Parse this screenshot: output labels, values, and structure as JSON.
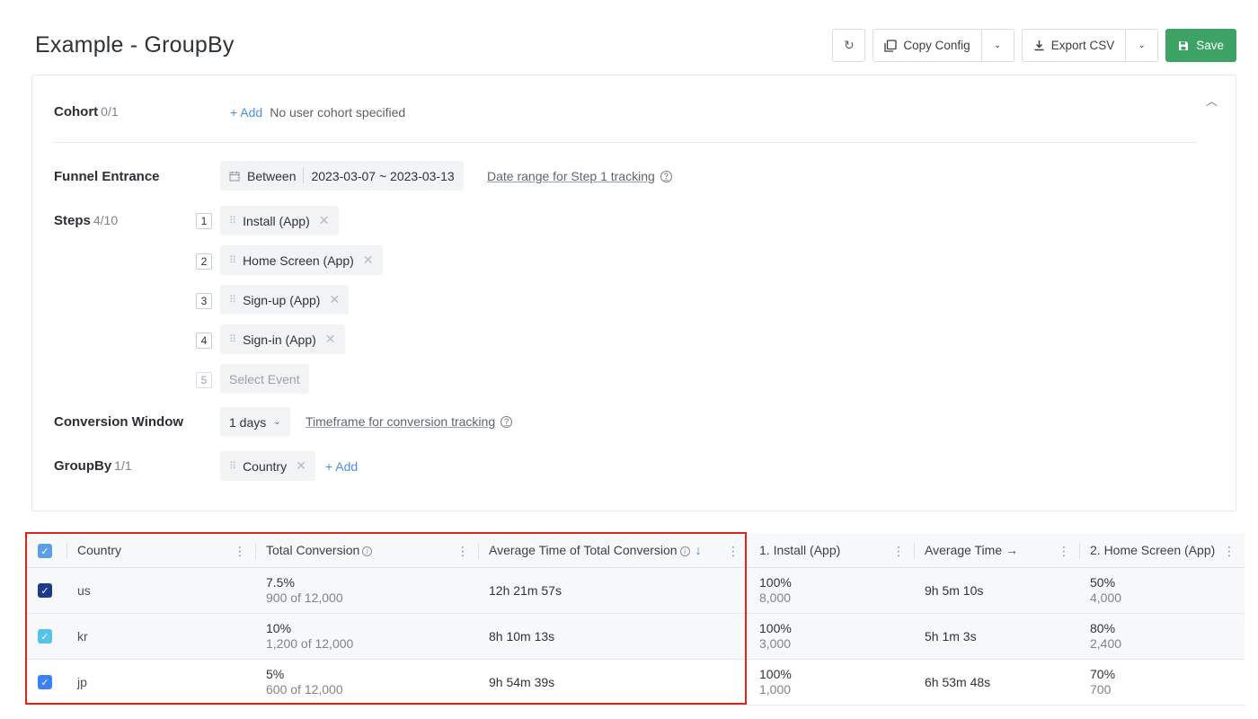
{
  "title": "Example - GroupBy",
  "toolbar": {
    "copy_config": "Copy Config",
    "export_csv": "Export CSV",
    "save": "Save"
  },
  "config": {
    "cohort": {
      "label": "Cohort",
      "count": "0/1",
      "add": "+ Add",
      "empty": "No user cohort specified"
    },
    "funnel_entrance": {
      "label": "Funnel Entrance",
      "mode": "Between",
      "range": "2023-03-07 ~ 2023-03-13",
      "help_link": "Date range for Step 1 tracking"
    },
    "steps": {
      "label": "Steps",
      "count": "4/10",
      "items": [
        {
          "num": "1",
          "name": "Install (App)"
        },
        {
          "num": "2",
          "name": "Home Screen (App)"
        },
        {
          "num": "3",
          "name": "Sign-up (App)"
        },
        {
          "num": "4",
          "name": "Sign-in (App)"
        }
      ],
      "next_num": "5",
      "select_placeholder": "Select Event"
    },
    "conversion_window": {
      "label": "Conversion Window",
      "value": "1 days",
      "help_link": "Timeframe for conversion tracking"
    },
    "groupby": {
      "label": "GroupBy",
      "count": "1/1",
      "item": "Country",
      "add": "+ Add"
    }
  },
  "table": {
    "headers": {
      "country": "Country",
      "total_conversion": "Total Conversion",
      "avg_time_total": "Average Time of Total Conversion",
      "step1": "1. Install (App)",
      "avg_time": "Average Time →",
      "step2": "2. Home Screen (App)"
    },
    "rows": [
      {
        "country": "us",
        "conv_pct": "7.5%",
        "conv_of": "900 of 12,000",
        "avg_total": "12h 21m 57s",
        "s1_pct": "100%",
        "s1_count": "8,000",
        "avg": "9h 5m 10s",
        "s2_pct": "50%",
        "s2_count": "4,000",
        "color": "#1f3a8a"
      },
      {
        "country": "kr",
        "conv_pct": "10%",
        "conv_of": "1,200 of 12,000",
        "avg_total": "8h 10m 13s",
        "s1_pct": "100%",
        "s1_count": "3,000",
        "avg": "5h 1m 3s",
        "s2_pct": "80%",
        "s2_count": "2,400",
        "color": "#56c2ea"
      },
      {
        "country": "jp",
        "conv_pct": "5%",
        "conv_of": "600 of 12,000",
        "avg_total": "9h 54m 39s",
        "s1_pct": "100%",
        "s1_count": "1,000",
        "avg": "6h 53m 48s",
        "s2_pct": "70%",
        "s2_count": "700",
        "color": "#3b82f6"
      }
    ]
  },
  "colors": {
    "save": "#3da364",
    "link": "#4a8fe7",
    "highlight_border": "#e2231a",
    "header_checkbox": "#5a9ee8"
  }
}
